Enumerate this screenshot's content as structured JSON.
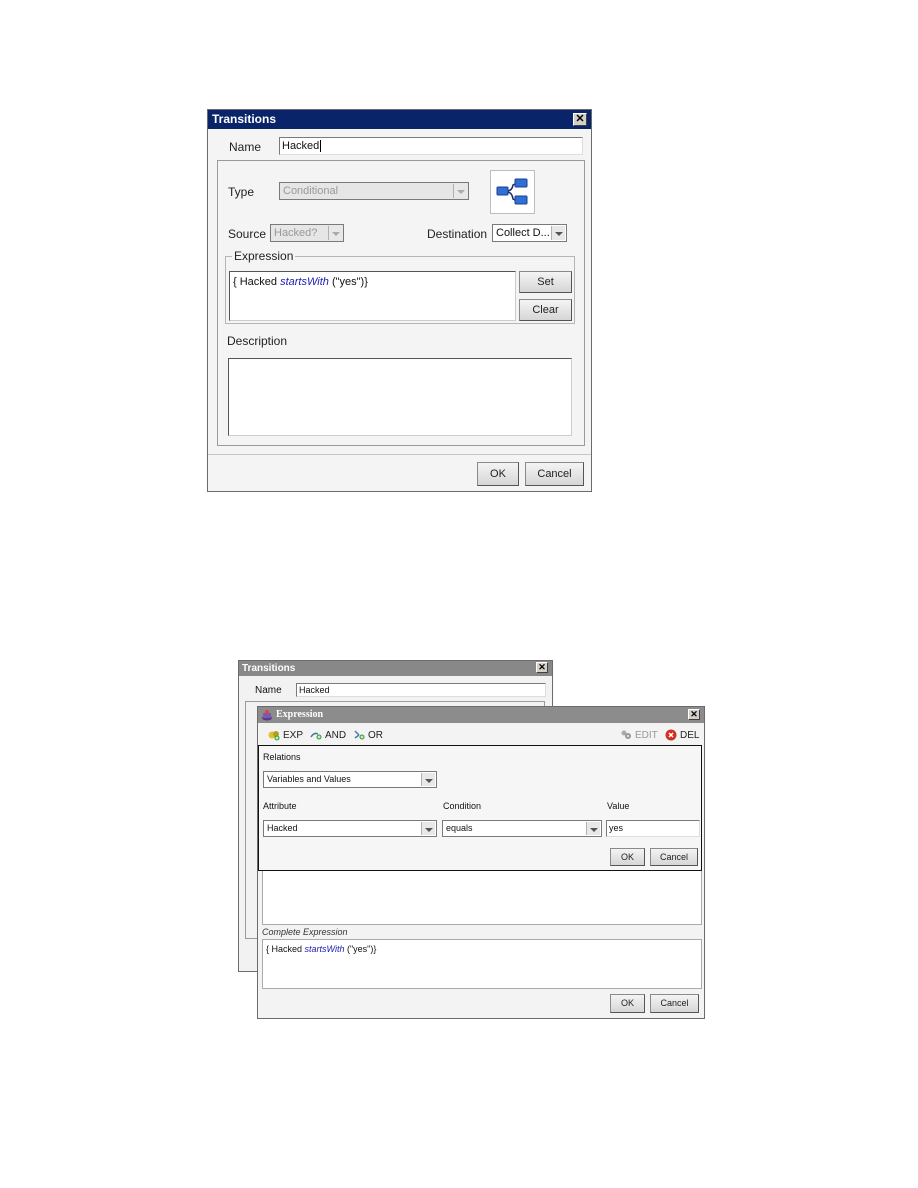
{
  "transitions_dialog": {
    "title": "Transitions",
    "close_glyph": "✕",
    "name_label": "Name",
    "name_value": "Hacked",
    "type_label": "Type",
    "type_value": "Conditional",
    "type_icon": "conditional-branch-icon",
    "source_label": "Source",
    "source_value": "Hacked?",
    "destination_label": "Destination",
    "destination_value": "Collect D...",
    "expression_group_label": "Expression",
    "expression": {
      "open": "{ Hacked ",
      "operator": "startsWith",
      "close": " (\"yes\")}"
    },
    "set_button": "Set",
    "clear_button": "Clear",
    "description_label": "Description",
    "description_value": "",
    "ok_button": "OK",
    "cancel_button": "Cancel"
  },
  "background_transitions_dialog": {
    "title": "Transitions",
    "close_glyph": "✕",
    "name_label": "Name",
    "name_value": "Hacked"
  },
  "expression_dialog": {
    "title": "Expression",
    "close_glyph": "✕",
    "toolbar": {
      "exp_label": "EXP",
      "and_label": "AND",
      "or_label": "OR",
      "edit_label": "EDIT",
      "del_label": "DEL"
    },
    "relations_label": "Relations",
    "relations_value": "Variables and Values",
    "attribute_label": "Attribute",
    "attribute_value": "Hacked",
    "condition_label": "Condition",
    "condition_value": "equals",
    "value_label": "Value",
    "value_value": "yes",
    "inner_ok_button": "OK",
    "inner_cancel_button": "Cancel",
    "complete_expression_label": "Complete Expression",
    "complete_expression": {
      "open": "{ Hacked ",
      "operator": "startsWith",
      "close": " (\"yes\")}"
    },
    "ok_button": "OK",
    "cancel_button": "Cancel"
  }
}
